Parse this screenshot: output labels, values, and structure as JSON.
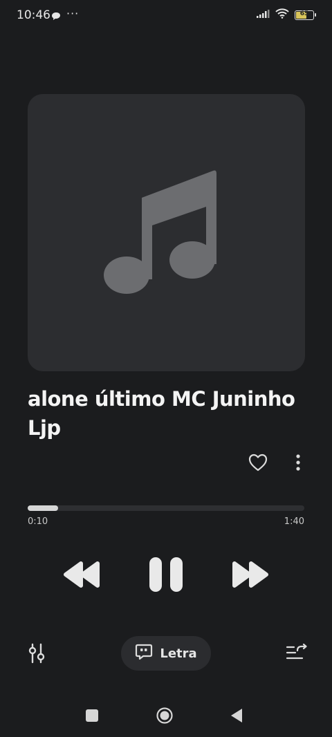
{
  "status": {
    "time": "10:46",
    "dots": "···",
    "battery": "65",
    "battery_level": 0.65
  },
  "track": {
    "title": "alone último MC Juninho Ljp",
    "elapsed": "0:10",
    "duration": "1:40",
    "progress": 0.11
  },
  "lyrics": {
    "label": "Letra"
  },
  "colors": {
    "background": "#1b1c1e",
    "artwork_bg": "#2c2d30",
    "note_icon": "#6c6d70",
    "progress_fill": "#d6d6d6"
  },
  "icons": {
    "artwork": "music-note-icon",
    "favorite": "heart-icon",
    "more": "more-vertical-icon",
    "rewind": "rewind-icon",
    "pause": "pause-icon",
    "forward": "fast-forward-icon",
    "equalizer": "equalizer-icon",
    "lyrics": "lyrics-quote-icon",
    "queue": "queue-repeat-icon"
  }
}
